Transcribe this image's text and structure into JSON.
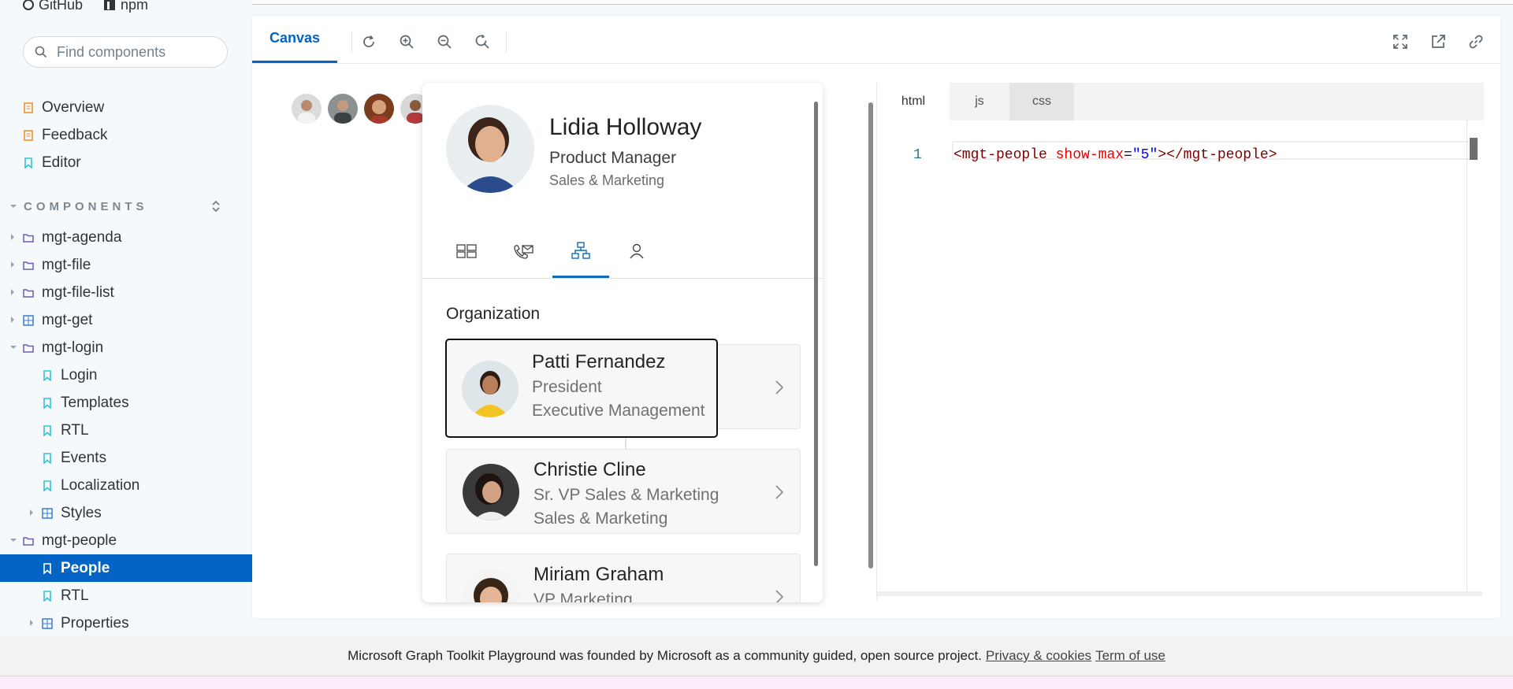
{
  "toplinks": {
    "github": "GitHub",
    "npm": "npm"
  },
  "search": {
    "placeholder": "Find components"
  },
  "sidebar": {
    "top_items": [
      {
        "label": "Overview",
        "icon": "document-icon"
      },
      {
        "label": "Feedback",
        "icon": "document-icon"
      },
      {
        "label": "Editor",
        "icon": "bookmark-icon"
      }
    ],
    "components_header": "COMPONENTS",
    "tree": [
      {
        "label": "mgt-agenda",
        "icon": "folder-icon"
      },
      {
        "label": "mgt-file",
        "icon": "folder-icon"
      },
      {
        "label": "mgt-file-list",
        "icon": "folder-icon"
      },
      {
        "label": "mgt-get",
        "icon": "component-icon"
      },
      {
        "label": "mgt-login",
        "icon": "folder-icon"
      },
      {
        "label": "Login",
        "icon": "bookmark-icon"
      },
      {
        "label": "Templates",
        "icon": "bookmark-icon"
      },
      {
        "label": "RTL",
        "icon": "bookmark-icon"
      },
      {
        "label": "Events",
        "icon": "bookmark-icon"
      },
      {
        "label": "Localization",
        "icon": "bookmark-icon"
      },
      {
        "label": "Styles",
        "icon": "component-icon"
      },
      {
        "label": "mgt-people",
        "icon": "folder-icon"
      },
      {
        "label": "People",
        "icon": "bookmark-icon",
        "selected": true
      },
      {
        "label": "RTL",
        "icon": "bookmark-icon"
      },
      {
        "label": "Properties",
        "icon": "component-icon"
      }
    ]
  },
  "toolbar": {
    "canvas_tab": "Canvas"
  },
  "card": {
    "name": "Lidia Holloway",
    "title": "Product Manager",
    "department": "Sales & Marketing",
    "org_heading": "Organization",
    "people": [
      {
        "name": "Patti Fernandez",
        "title": "President",
        "dept": "Executive Management"
      },
      {
        "name": "Christie Cline",
        "title": "Sr. VP Sales & Marketing",
        "dept": "Sales & Marketing"
      },
      {
        "name": "Miriam Graham",
        "title": "VP Marketing",
        "dept": ""
      }
    ]
  },
  "editor": {
    "tabs": [
      "html",
      "js",
      "css"
    ],
    "line_number": "1",
    "code": {
      "open_tag": "<mgt-people",
      "attr": " show-max",
      "eq": "=",
      "value": "\"5\"",
      "close": "></mgt-people>"
    }
  },
  "footer": {
    "text": "Microsoft Graph Toolkit Playground was founded by Microsoft as a community guided, open source project.",
    "privacy": "Privacy & cookies",
    "terms": "Term of use"
  },
  "colors": {
    "accent": "#0464c5",
    "selected_bg": "#0464c5",
    "doc_icon": "#f0912f",
    "bookmark_icon": "#2ec5d6",
    "folder_icon": "#6e5ab0"
  }
}
